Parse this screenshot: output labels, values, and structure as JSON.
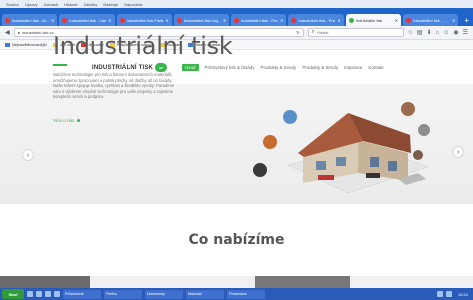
{
  "browser": {
    "menu": [
      "Soubor",
      "Úpravy",
      "Zobrazit",
      "Historie",
      "Záložky",
      "Nástroje",
      "Nápověda"
    ],
    "tabs": [
      {
        "title": "Industriální tisk - Ar...",
        "active": false
      },
      {
        "title": "Industriální tisk - Land...",
        "active": false
      },
      {
        "title": "Industriální tisk Fácb...",
        "active": false
      },
      {
        "title": "Industriální tisk vlaj...",
        "active": false
      },
      {
        "title": "Industriální tisk - Pro...",
        "active": false
      },
      {
        "title": "Industriální tisk - Pro...",
        "active": false
      },
      {
        "title": "Industriální tisk",
        "active": true
      },
      {
        "title": "Industriální tisk - ...",
        "active": false
      }
    ],
    "new_tab": "+",
    "url": "industrialni-tisk.cz",
    "search_placeholder": "Hledat",
    "bookmarks": [
      "Nejnavštěvovanější",
      "Jak začít",
      "Aktuality",
      "Přizpůsobení odkazů",
      "Seznam",
      "Hlavní stránka"
    ]
  },
  "site": {
    "logo_text": "INDUSTRIÁLNÍ TISK",
    "logo_mark": "cz",
    "nav": [
      "Úvod",
      "Průmyslový tisk & fasády",
      "Produkty & trendy",
      "Produkty & trendy",
      "Inspirace",
      "Kontakt"
    ],
    "hero": {
      "title": "Industriální tisk",
      "text": "Nabízíme technologie pro tisk a barvení dekorativních materiálů, umožňujeme zpracování a potisk plochy od dlažby až po fasády. Naše řešení spojuje kvalitu, rychlost a flexibilitu výroby. Poradíme vám s výběrem vhodné technologie pro vaše projekty a zajistíme kompletní servis a podporu.",
      "more": "Více o nás"
    },
    "arrow_left": "‹",
    "arrow_right": "›",
    "section_title": "Co nabízíme"
  },
  "taskbar": {
    "start": "Start",
    "items": [
      "Průzkumník",
      "Firefox",
      "Dokumenty",
      "Malování",
      "Prezentace"
    ],
    "clock": "10:24"
  },
  "colors": {
    "accent": "#39b54a",
    "tabbar": "#1f64c8",
    "taskbar": "#2a5bb8"
  }
}
